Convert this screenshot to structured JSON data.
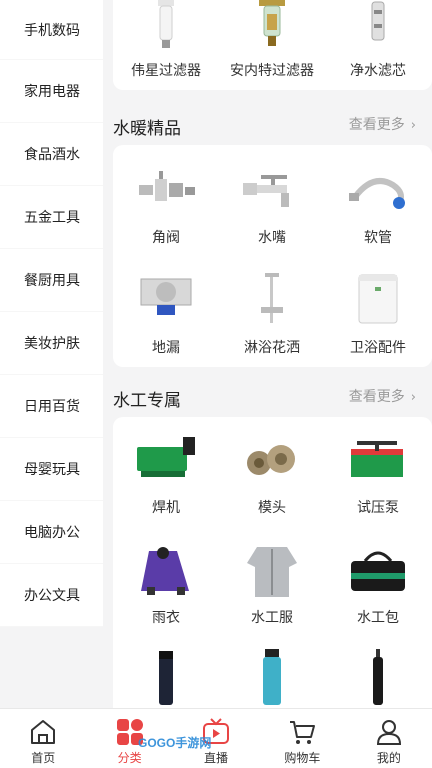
{
  "sidebar": {
    "items": [
      {
        "label": "手机数码"
      },
      {
        "label": "家用电器"
      },
      {
        "label": "食品酒水"
      },
      {
        "label": "五金工具"
      },
      {
        "label": "餐厨用具"
      },
      {
        "label": "美妆护肤"
      },
      {
        "label": "日用百货"
      },
      {
        "label": "母婴玩具"
      },
      {
        "label": "电脑办公"
      },
      {
        "label": "办公文具"
      }
    ]
  },
  "filters": {
    "items": [
      {
        "label": "伟星过滤器",
        "icon": "filter-icon"
      },
      {
        "label": "安内特过滤器",
        "icon": "brass-filter-icon"
      },
      {
        "label": "净水滤芯",
        "icon": "filter-cartridge-icon"
      }
    ]
  },
  "heating": {
    "title": "水暖精品",
    "more": "查看更多",
    "items": [
      {
        "label": "角阀",
        "icon": "angle-valve-icon"
      },
      {
        "label": "水嘴",
        "icon": "faucet-icon"
      },
      {
        "label": "软管",
        "icon": "hose-icon"
      },
      {
        "label": "地漏",
        "icon": "floor-drain-icon"
      },
      {
        "label": "淋浴花洒",
        "icon": "shower-icon"
      },
      {
        "label": "卫浴配件",
        "icon": "toilet-tank-icon"
      }
    ]
  },
  "plumber": {
    "title": "水工专属",
    "more": "查看更多",
    "items": [
      {
        "label": "焊机",
        "icon": "welder-icon"
      },
      {
        "label": "模头",
        "icon": "die-head-icon"
      },
      {
        "label": "试压泵",
        "icon": "pressure-pump-icon"
      },
      {
        "label": "雨衣",
        "icon": "raincoat-icon"
      },
      {
        "label": "水工服",
        "icon": "work-jacket-icon"
      },
      {
        "label": "水工包",
        "icon": "tool-bag-icon"
      },
      {
        "label": "",
        "icon": "thermos-black-icon"
      },
      {
        "label": "",
        "icon": "bottle-teal-icon"
      },
      {
        "label": "",
        "icon": "umbrella-icon"
      }
    ]
  },
  "tabbar": {
    "items": [
      {
        "label": "首页",
        "icon": "home-icon"
      },
      {
        "label": "分类",
        "icon": "category-icon"
      },
      {
        "label": "直播",
        "icon": "live-icon"
      },
      {
        "label": "购物车",
        "icon": "cart-icon"
      },
      {
        "label": "我的",
        "icon": "profile-icon"
      }
    ],
    "active_color": "#e84545"
  },
  "watermark": "GOGO手游网"
}
